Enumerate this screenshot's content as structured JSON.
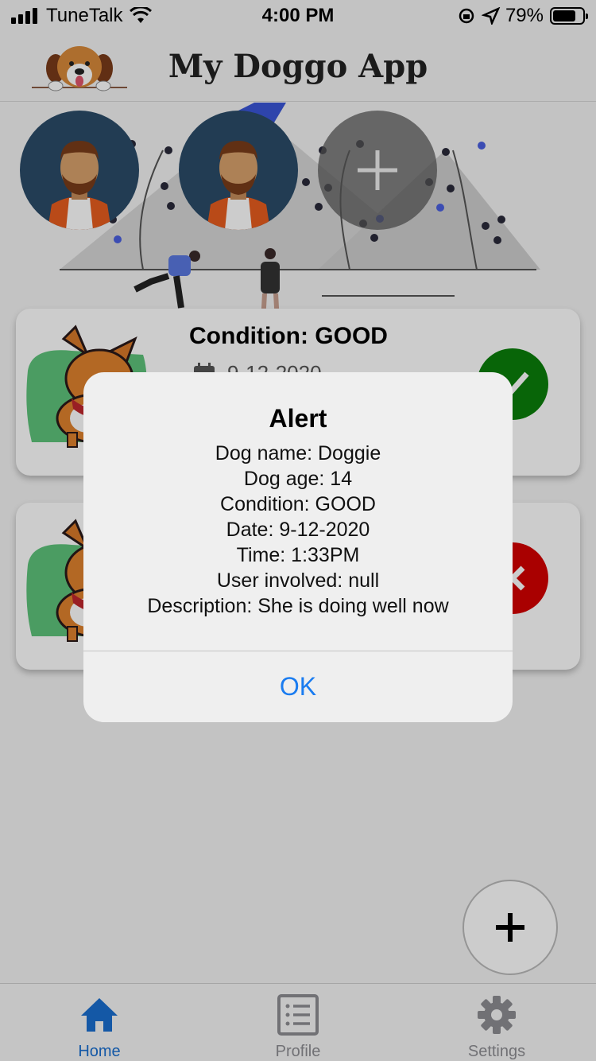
{
  "status_bar": {
    "carrier": "TuneTalk",
    "time": "4:00 PM",
    "battery": "79%",
    "battery_level": 0.79,
    "icons": [
      "signal-icon",
      "wifi-icon",
      "orientation-lock-icon",
      "location-icon",
      "battery-icon"
    ]
  },
  "header": {
    "title": "My Doggo App",
    "logo_icon": "dog-logo-icon"
  },
  "hero": {
    "avatars": [
      "user-avatar",
      "user-avatar"
    ],
    "add_user_icon": "plus-icon"
  },
  "cards": [
    {
      "title": "Condition: GOOD",
      "date": "9-12-2020",
      "status": "good",
      "status_icon": "check-icon",
      "status_color": "#0a7f0a"
    },
    {
      "title": "",
      "date": "",
      "status": "bad",
      "status_icon": "close-icon",
      "status_color": "#d40000"
    }
  ],
  "fab": {
    "icon": "plus-icon"
  },
  "tabs": [
    {
      "label": "Home",
      "icon": "home-icon",
      "active": true
    },
    {
      "label": "Profile",
      "icon": "list-icon",
      "active": false
    },
    {
      "label": "Settings",
      "icon": "gear-icon",
      "active": false
    }
  ],
  "alert": {
    "title": "Alert",
    "lines": [
      "Dog name: Doggie",
      "Dog age: 14",
      "Condition: GOOD",
      "Date: 9-12-2020",
      "Time: 1:33PM",
      "User involved: null",
      "Description: She is doing well now"
    ],
    "ok_label": "OK"
  },
  "colors": {
    "accent": "#1a7cf0",
    "tab_active": "#1a6fd0",
    "good": "#0a7f0a",
    "bad": "#d40000",
    "avatar_bg": "#2b4b68"
  }
}
